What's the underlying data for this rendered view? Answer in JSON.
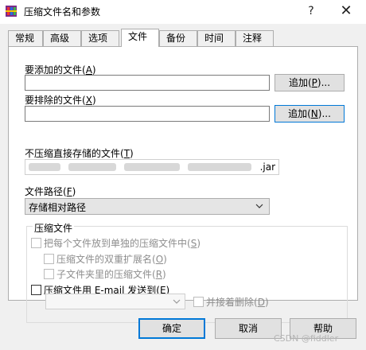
{
  "window": {
    "title": "压缩文件名和参数",
    "help_glyph": "?",
    "close_glyph": "✕"
  },
  "tabs": [
    {
      "label": "常规",
      "active": false
    },
    {
      "label": "高级",
      "active": false
    },
    {
      "label": "选项",
      "active": false
    },
    {
      "label": "文件",
      "active": true
    },
    {
      "label": "备份",
      "active": false
    },
    {
      "label": "时间",
      "active": false
    },
    {
      "label": "注释",
      "active": false
    }
  ],
  "files_to_add": {
    "label": "要添加的文件",
    "accel": "A",
    "value": "",
    "button_label": "追加",
    "button_accel": "P",
    "button_suffix": "..."
  },
  "files_to_exclude": {
    "label": "要排除的文件",
    "accel": "X",
    "value": "",
    "button_label": "追加",
    "button_accel": "N",
    "button_suffix": "..."
  },
  "store_uncompressed": {
    "label": "不压缩直接存储的文件",
    "accel": "T",
    "value_visible": ".jar"
  },
  "file_path": {
    "label": "文件路径",
    "accel": "F",
    "selected": "存储相对路径"
  },
  "compress_group": {
    "title": "压缩文件",
    "separate_archives": {
      "label": "把每个文件放到单独的压缩文件中",
      "accel": "S",
      "checked": false,
      "enabled": false
    },
    "double_ext": {
      "label": "压缩文件的双重扩展名",
      "accel": "O",
      "checked": false,
      "enabled": false
    },
    "subfolder": {
      "label": "子文件夹里的压缩文件",
      "accel": "R",
      "checked": false,
      "enabled": false
    },
    "email": {
      "label": "压缩文件用 E-mail 发送到",
      "accel": "E",
      "checked": false,
      "enabled": true
    },
    "email_target": "",
    "delete_after": {
      "label": "并接着删除",
      "accel": "D",
      "checked": false,
      "enabled": false
    }
  },
  "buttons": {
    "ok": "确定",
    "cancel": "取消",
    "help": "帮助"
  },
  "watermark": "CSDN @fiddler"
}
